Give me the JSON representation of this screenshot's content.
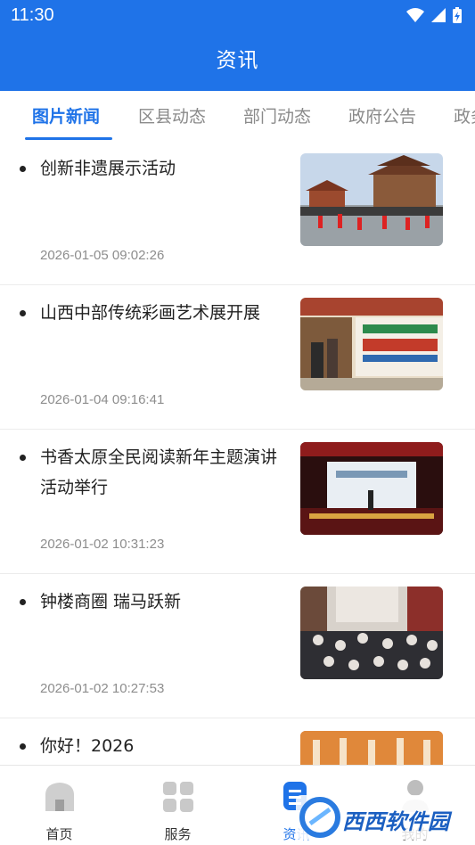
{
  "status_bar": {
    "time": "11:30"
  },
  "header": {
    "title": "资讯"
  },
  "tabs": [
    {
      "label": "图片新闻",
      "active": true
    },
    {
      "label": "区县动态",
      "active": false
    },
    {
      "label": "部门动态",
      "active": false
    },
    {
      "label": "政府公告",
      "active": false
    },
    {
      "label": "政务",
      "active": false
    }
  ],
  "news": [
    {
      "title": "创新非遗展示活动",
      "date": "2026-01-05 09:02:26"
    },
    {
      "title": "山西中部传统彩画艺术展开展",
      "date": "2026-01-04 09:16:41"
    },
    {
      "title": "书香太原全民阅读新年主题演讲活动举行",
      "date": "2026-01-02 10:31:23"
    },
    {
      "title": "钟楼商圈 瑞马跃新",
      "date": "2026-01-02 10:27:53"
    },
    {
      "title": "你好！2026",
      "date": ""
    }
  ],
  "bottom_nav": [
    {
      "label": "首页",
      "icon": "home-icon"
    },
    {
      "label": "服务",
      "icon": "grid-icon"
    },
    {
      "label": "资讯",
      "icon": "news-icon"
    },
    {
      "label": "我的",
      "icon": "profile-icon"
    }
  ],
  "watermark": {
    "text": "西西软件园"
  },
  "colors": {
    "primary": "#1f73e8",
    "text": "#222222",
    "muted": "#8d8d8d"
  }
}
